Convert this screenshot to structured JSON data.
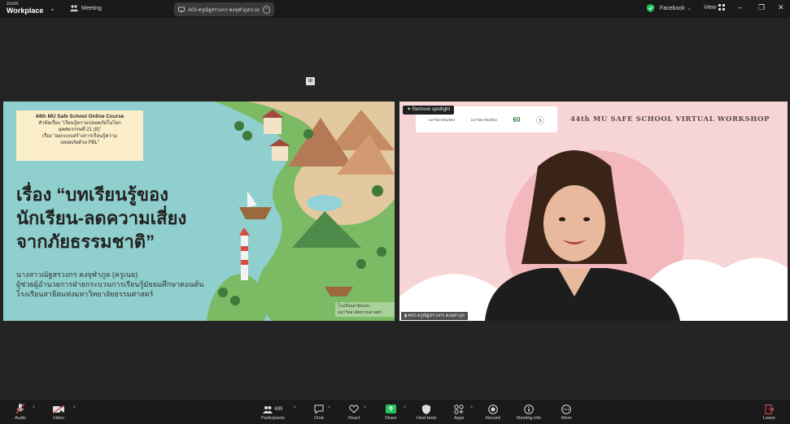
{
  "app": {
    "brand_top": "zoom",
    "brand_name": "Workplace"
  },
  "topbar": {
    "meeting_label": "Meeting",
    "tab_title": "A02-ครูณัฐสรวงกร คงจุฬาภูล's sc",
    "facebook_label": "Facebook",
    "view_label": "View"
  },
  "gallery_chip": "⊞",
  "slide": {
    "course_lines": [
      "44th MU Safe School Online Course",
      "หัวข้อเรื่อง \"เรียนรู้ความปลอดภัยในโลก",
      "ยุคศตวรรษที่ 21 (8)\"",
      "เรื่อง \"ออกแบบสร้างการเรียนรู้ความ",
      "ปลอดภัยด้วย PBL\""
    ],
    "title_lines": [
      "เรื่อง “บทเรียนรู้ของ",
      "นักเรียน-ลดความเสี่ยง",
      "จากภัยธรรมชาติ”"
    ],
    "author_lines": [
      "นางสาวณัฐสรวงกร คงจุฬาภูล (ครูเนย)",
      "ผู้ช่วยผู้อำนวยการฝ่ายกระบวนการเรียนรู้มัธยมศึกษาตอนต้น",
      "โรงเรียนสาธิตแห่งมหาวิทยาลัยธรรมศาสตร์"
    ],
    "logo_text": "โรงเรียนสาธิตแห่ง มหาวิทยาลัยธรรมศาสตร์"
  },
  "camera": {
    "spotlight_label": "Remove spotlight",
    "workshop_title": "44th MU SAFE SCHOOL VIRTUAL WORKSHOP",
    "name_tag": "A02-ครูณัฐสรวงกร คงจุฬาภูล",
    "logo_items": [
      "มหาวิทยาลัยมหิดล",
      "มหาวิทยาลัยมหิดล",
      "60",
      "ⓢ"
    ]
  },
  "toolbar": {
    "audio": "Audio",
    "video": "Video",
    "participants": "Participants",
    "participants_count": "699",
    "chat": "Chat",
    "react": "React",
    "share": "Share",
    "host_tools": "Host tools",
    "apps": "Apps",
    "record": "Record",
    "meeting_info": "Meeting info",
    "more": "More",
    "leave": "Leave"
  },
  "colors": {
    "accent_green": "#22c55e",
    "leave_red": "#e5484d",
    "slide_bg": "#8fcfcd",
    "camera_bg": "#f7d4d6"
  }
}
